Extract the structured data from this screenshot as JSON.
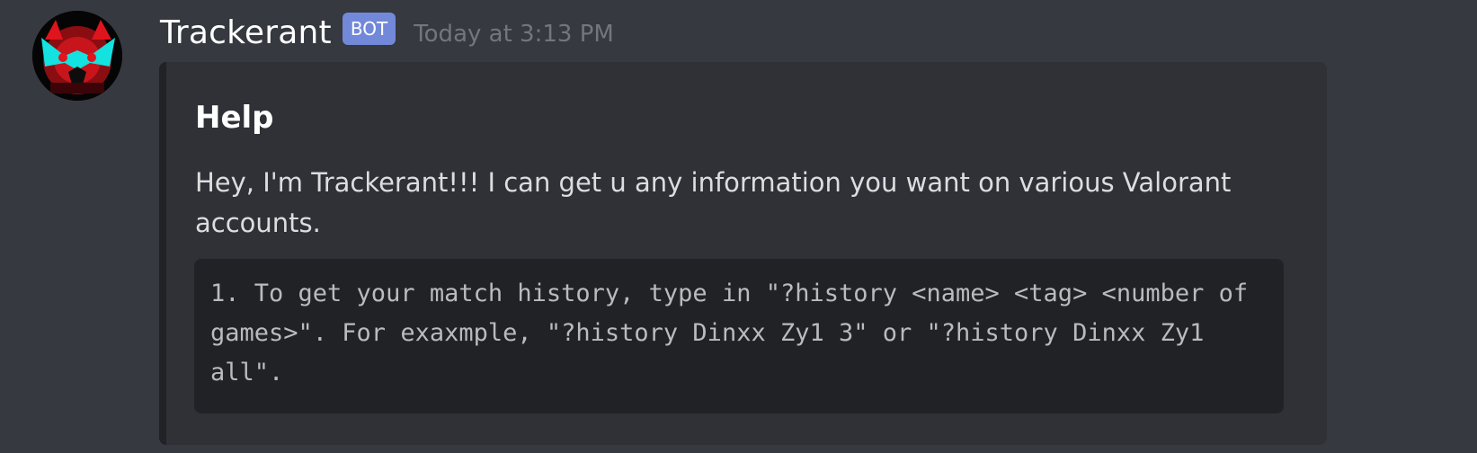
{
  "message": {
    "author": {
      "username": "Trackerant",
      "badge": "BOT",
      "avatar_icon": "masked-face-avatar-icon"
    },
    "timestamp": "Today at 3:13 PM",
    "embed": {
      "title": "Help",
      "description": "Hey, I'm Trackerant!!! I can get u any information you want on various Valorant accounts.",
      "code_block": "1. To get your match history, type in \"?history <name> <tag> <number of games>\". For exaxmple, \"?history Dinxx Zy1 3\" or \"?history Dinxx Zy1 all\"."
    }
  },
  "colors": {
    "background": "#36393f",
    "embed_background": "#2f3136",
    "code_background": "#202225",
    "bot_badge": "#7289da",
    "timestamp": "#72767d"
  }
}
